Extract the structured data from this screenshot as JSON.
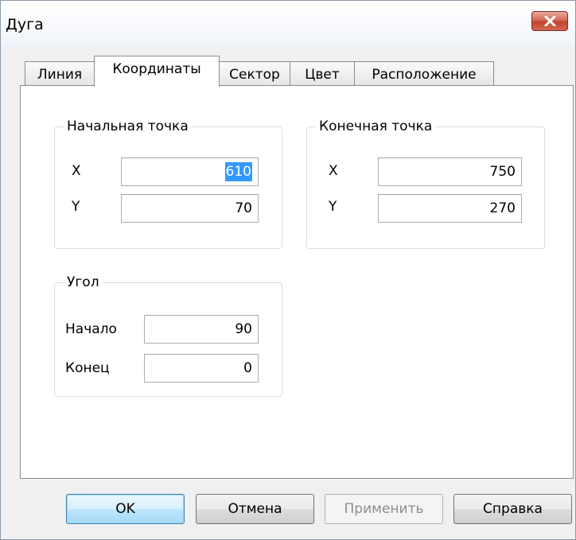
{
  "window": {
    "title": "Дуга"
  },
  "tabs": [
    {
      "label": "Линия"
    },
    {
      "label": "Координаты"
    },
    {
      "label": "Сектор"
    },
    {
      "label": "Цвет"
    },
    {
      "label": "Расположение"
    }
  ],
  "start_point": {
    "legend": "Начальная точка",
    "x_label": "X",
    "x_value": "610",
    "y_label": "Y",
    "y_value": "70"
  },
  "end_point": {
    "legend": "Конечная точка",
    "x_label": "X",
    "x_value": "750",
    "y_label": "Y",
    "y_value": "270"
  },
  "angle": {
    "legend": "Угол",
    "start_label": "Начало",
    "start_value": "90",
    "end_label": "Конец",
    "end_value": "0"
  },
  "buttons": {
    "ok": "OK",
    "cancel": "Отмена",
    "apply": "Применить",
    "help": "Справка"
  }
}
